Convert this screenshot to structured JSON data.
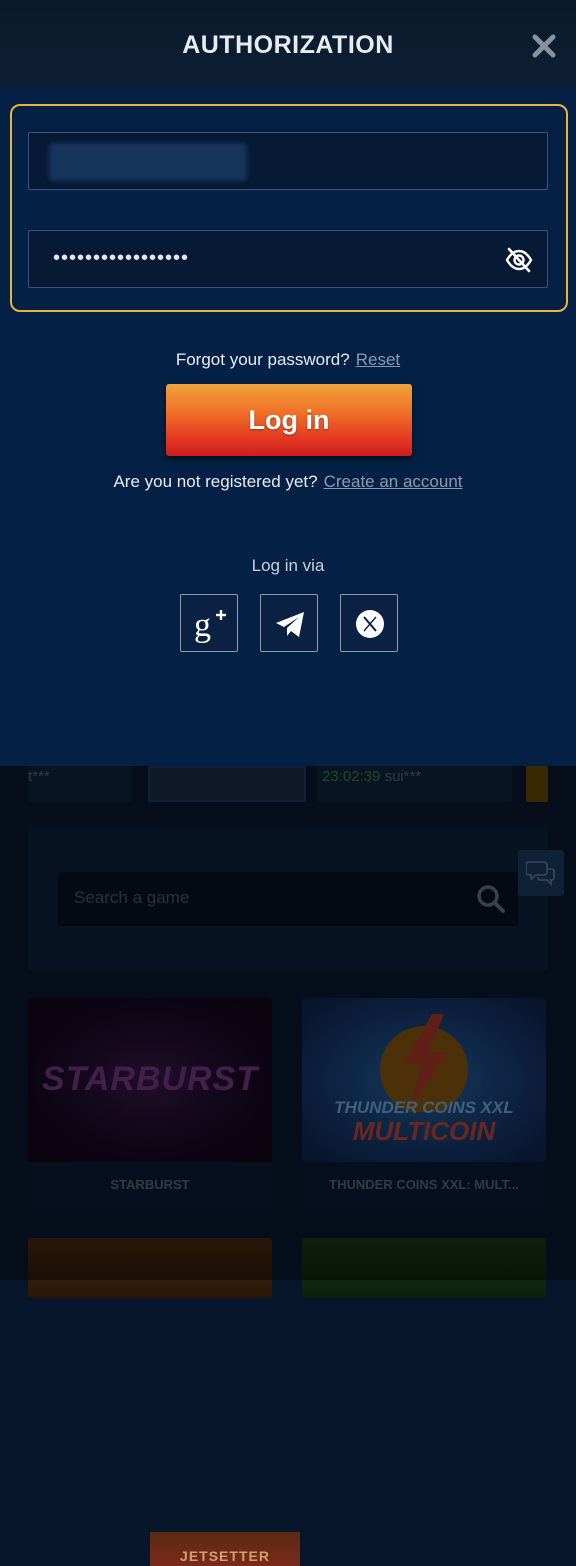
{
  "modal": {
    "title": "AUTHORIZATION",
    "password_mask": "•••••••••••••••••",
    "forgot_text": "Forgot your password?",
    "reset_link": "Reset",
    "login_button": "Log in",
    "register_text": "Are you not registered yet?",
    "create_account_link": "Create an account",
    "login_via": "Log in via",
    "social": [
      {
        "name": "google-plus",
        "icon": "google-plus-icon"
      },
      {
        "name": "telegram",
        "icon": "telegram-icon"
      },
      {
        "name": "x",
        "icon": "x-icon"
      }
    ],
    "colors": {
      "accent_border": "#e8b43a",
      "button_top": "#f0a23a",
      "button_bottom": "#cc1e1e",
      "modal_bg": "#042145"
    }
  },
  "background": {
    "winners": [
      {
        "user": "t***"
      },
      {
        "game": "JETSETTER"
      },
      {
        "time": "23:02:39",
        "user": "sui***"
      }
    ],
    "search": {
      "placeholder": "Search a game"
    },
    "games": [
      {
        "logo": "STARBURST",
        "name": "STARBURST"
      },
      {
        "logo_line1": "THUNDER COINS XXL",
        "logo_line2": "MULTICOIN",
        "name": "THUNDER COINS XXL: MULT..."
      }
    ]
  }
}
